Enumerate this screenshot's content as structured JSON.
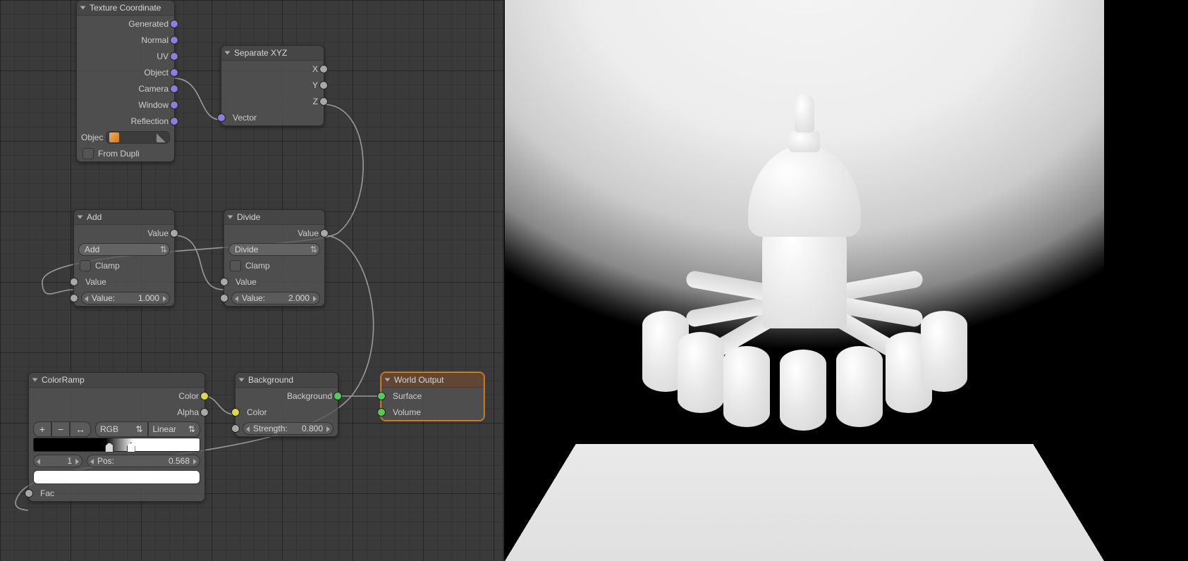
{
  "nodes": {
    "texcoord": {
      "title": "Texture Coordinate",
      "outputs": {
        "generated": "Generated",
        "normal": "Normal",
        "uv": "UV",
        "object": "Object",
        "camera": "Camera",
        "window": "Window",
        "reflection": "Reflection"
      },
      "object_label": "Objec",
      "from_dupli": "From Dupli"
    },
    "sepxyz": {
      "title": "Separate XYZ",
      "x": "X",
      "y": "Y",
      "z": "Z",
      "vector": "Vector"
    },
    "add": {
      "title": "Add",
      "value_out": "Value",
      "op": "Add",
      "clamp": "Clamp",
      "value_in": "Value",
      "num_label": "Value:",
      "num_val": "1.000"
    },
    "divide": {
      "title": "Divide",
      "value_out": "Value",
      "op": "Divide",
      "clamp": "Clamp",
      "value_in": "Value",
      "num_label": "Value:",
      "num_val": "2.000"
    },
    "ramp": {
      "title": "ColorRamp",
      "color": "Color",
      "alpha": "Alpha",
      "fac": "Fac",
      "mode": "RGB",
      "interp": "Linear",
      "index": "1",
      "pos_label": "Pos:",
      "pos_val": "0.568"
    },
    "background": {
      "title": "Background",
      "out": "Background",
      "color": "Color",
      "strength_label": "Strength:",
      "strength_val": "0.800"
    },
    "world": {
      "title": "World Output",
      "surface": "Surface",
      "volume": "Volume"
    }
  }
}
